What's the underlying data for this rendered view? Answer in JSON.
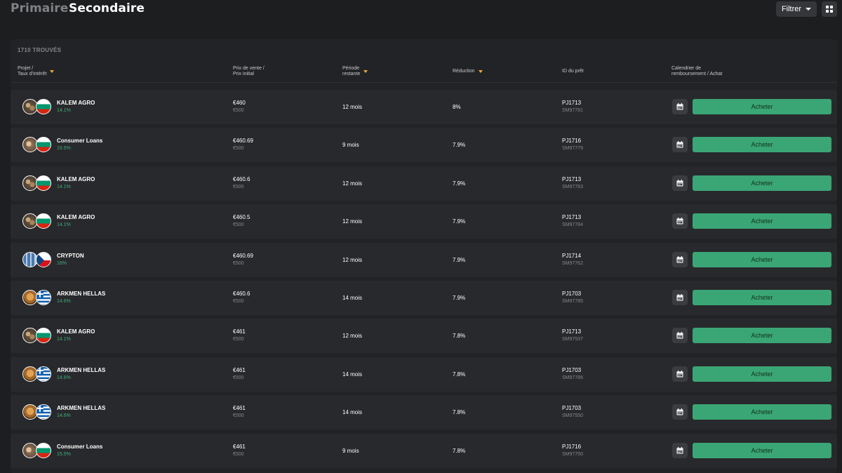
{
  "tabs": {
    "primary": "Primaire",
    "secondary": "Secondaire"
  },
  "toolbar": {
    "filter_label": "Filtrer",
    "grid_icon": "grid-view-icon"
  },
  "results": {
    "count_label": "1710 TROUVÉS"
  },
  "columns": {
    "project": [
      "Projet /",
      "Taux d'intérêt"
    ],
    "price": [
      "Prix de vente /",
      "Prix initial"
    ],
    "period": [
      "Période",
      "restante"
    ],
    "discount": "Réduction",
    "loan_id": "ID du prêt",
    "schedule": [
      "Calendrier de",
      "remboursement / Achat"
    ]
  },
  "colors": {
    "accent_green": "#3aa675",
    "rate_green": "#3fae7d",
    "sort_orange": "#f0a73a"
  },
  "rows": [
    {
      "name": "KALEM AGRO",
      "rate": "14.1%",
      "price": "€460",
      "initial": "€500",
      "period": "12 mois",
      "discount": "8%",
      "loan_id": "PJ1713",
      "sub_id": "SM97781",
      "action": "Acheter",
      "flag": "bulgaria",
      "image": "nuts"
    },
    {
      "name": "Consumer Loans",
      "rate": "15.5%",
      "price": "€460.69",
      "initial": "€500",
      "period": "9 mois",
      "discount": "7.9%",
      "loan_id": "PJ1716",
      "sub_id": "SM97779",
      "action": "Acheter",
      "flag": "bulgaria",
      "image": "people"
    },
    {
      "name": "KALEM AGRO",
      "rate": "14.1%",
      "price": "€460.6",
      "initial": "€500",
      "period": "12 mois",
      "discount": "7.9%",
      "loan_id": "PJ1713",
      "sub_id": "SM97783",
      "action": "Acheter",
      "flag": "bulgaria",
      "image": "nuts"
    },
    {
      "name": "KALEM AGRO",
      "rate": "14.1%",
      "price": "€460.5",
      "initial": "€500",
      "period": "12 mois",
      "discount": "7.9%",
      "loan_id": "PJ1713",
      "sub_id": "SM97784",
      "action": "Acheter",
      "flag": "bulgaria",
      "image": "nuts"
    },
    {
      "name": "CRYPTON",
      "rate": "16%",
      "price": "€460.69",
      "initial": "€500",
      "period": "12 mois",
      "discount": "7.9%",
      "loan_id": "PJ1714",
      "sub_id": "SM97762",
      "action": "Acheter",
      "flag": "czech",
      "image": "building"
    },
    {
      "name": "ARKMEN HELLAS",
      "rate": "14.6%",
      "price": "€460.6",
      "initial": "€500",
      "period": "14 mois",
      "discount": "7.9%",
      "loan_id": "PJ1703",
      "sub_id": "SM97785",
      "action": "Acheter",
      "flag": "greece",
      "image": "bread"
    },
    {
      "name": "KALEM AGRO",
      "rate": "14.1%",
      "price": "€461",
      "initial": "€500",
      "period": "12 mois",
      "discount": "7.8%",
      "loan_id": "PJ1713",
      "sub_id": "SM97537",
      "action": "Acheter",
      "flag": "bulgaria",
      "image": "nuts"
    },
    {
      "name": "ARKMEN HELLAS",
      "rate": "14.6%",
      "price": "€461",
      "initial": "€500",
      "period": "14 mois",
      "discount": "7.8%",
      "loan_id": "PJ1703",
      "sub_id": "SM97786",
      "action": "Acheter",
      "flag": "greece",
      "image": "bread"
    },
    {
      "name": "ARKMEN HELLAS",
      "rate": "14.6%",
      "price": "€461",
      "initial": "€500",
      "period": "14 mois",
      "discount": "7.8%",
      "loan_id": "PJ1703",
      "sub_id": "SM97550",
      "action": "Acheter",
      "flag": "greece",
      "image": "bread"
    },
    {
      "name": "Consumer Loans",
      "rate": "15.5%",
      "price": "€461",
      "initial": "€500",
      "period": "9 mois",
      "discount": "7.8%",
      "loan_id": "PJ1716",
      "sub_id": "SM97750",
      "action": "Acheter",
      "flag": "bulgaria",
      "image": "people"
    }
  ]
}
